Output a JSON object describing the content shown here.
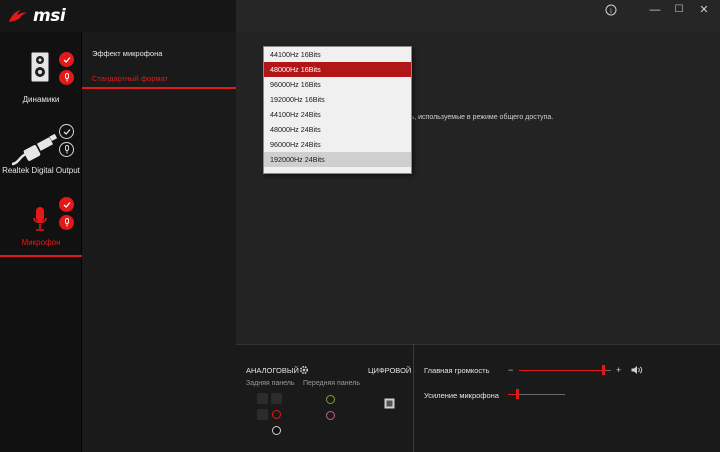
{
  "app": {
    "brand": "msi",
    "brand_color": "#e21919",
    "window_buttons": [
      "info-icon",
      "minimize-icon",
      "maximize-icon",
      "close-icon"
    ],
    "window_glyphs": {
      "info": "i",
      "minimize": "—",
      "maximize": "☐",
      "close": "✕"
    }
  },
  "sidebar": {
    "devices": [
      {
        "label": "Динамики",
        "icon": "speaker-icon",
        "default_badge": "check-red",
        "comm_badge": "mic-red"
      },
      {
        "label": "Realtek Digital Output",
        "icon": "optical-cable-icon",
        "default_badge": "check-outline",
        "comm_badge": "mic-outline"
      },
      {
        "label": "Микрофон",
        "icon": "microphone-icon",
        "default_badge": "check-red",
        "comm_badge": "mic-red",
        "active": true
      }
    ]
  },
  "menu": {
    "items": [
      {
        "label": "Эффект микрофона",
        "active": false
      },
      {
        "label": "Стандартный формат",
        "active": true
      }
    ]
  },
  "main": {
    "info_text": "ость, используемые в режиме общего доступа."
  },
  "format_dropdown": {
    "options": [
      "44100Hz 16Bits",
      "48000Hz 16Bits",
      "96000Hz 16Bits",
      "192000Hz 16Bits",
      "44100Hz 24Bits",
      "48000Hz 24Bits",
      "96000Hz 24Bits",
      "192000Hz 24Bits"
    ],
    "selected": "48000Hz 16Bits",
    "hovered": "192000Hz 24Bits"
  },
  "connectors": {
    "analog_label": "АНАЛОГОВЫЙ",
    "digital_label": "ЦИФРОВОЙ",
    "rear_panel_label": "Задняя панель",
    "front_panel_label": "Передняя панель",
    "colors": {
      "red": "#e21919",
      "green": "#7aa33a",
      "pink": "#c4608a",
      "black": "#111111"
    }
  },
  "levels": {
    "main_volume_label": "Главная громкость",
    "main_volume_value": 0.92,
    "minus": "−",
    "plus": "+",
    "mic_boost_label": "Усиление микрофона",
    "mic_boost_value": 0.17
  }
}
